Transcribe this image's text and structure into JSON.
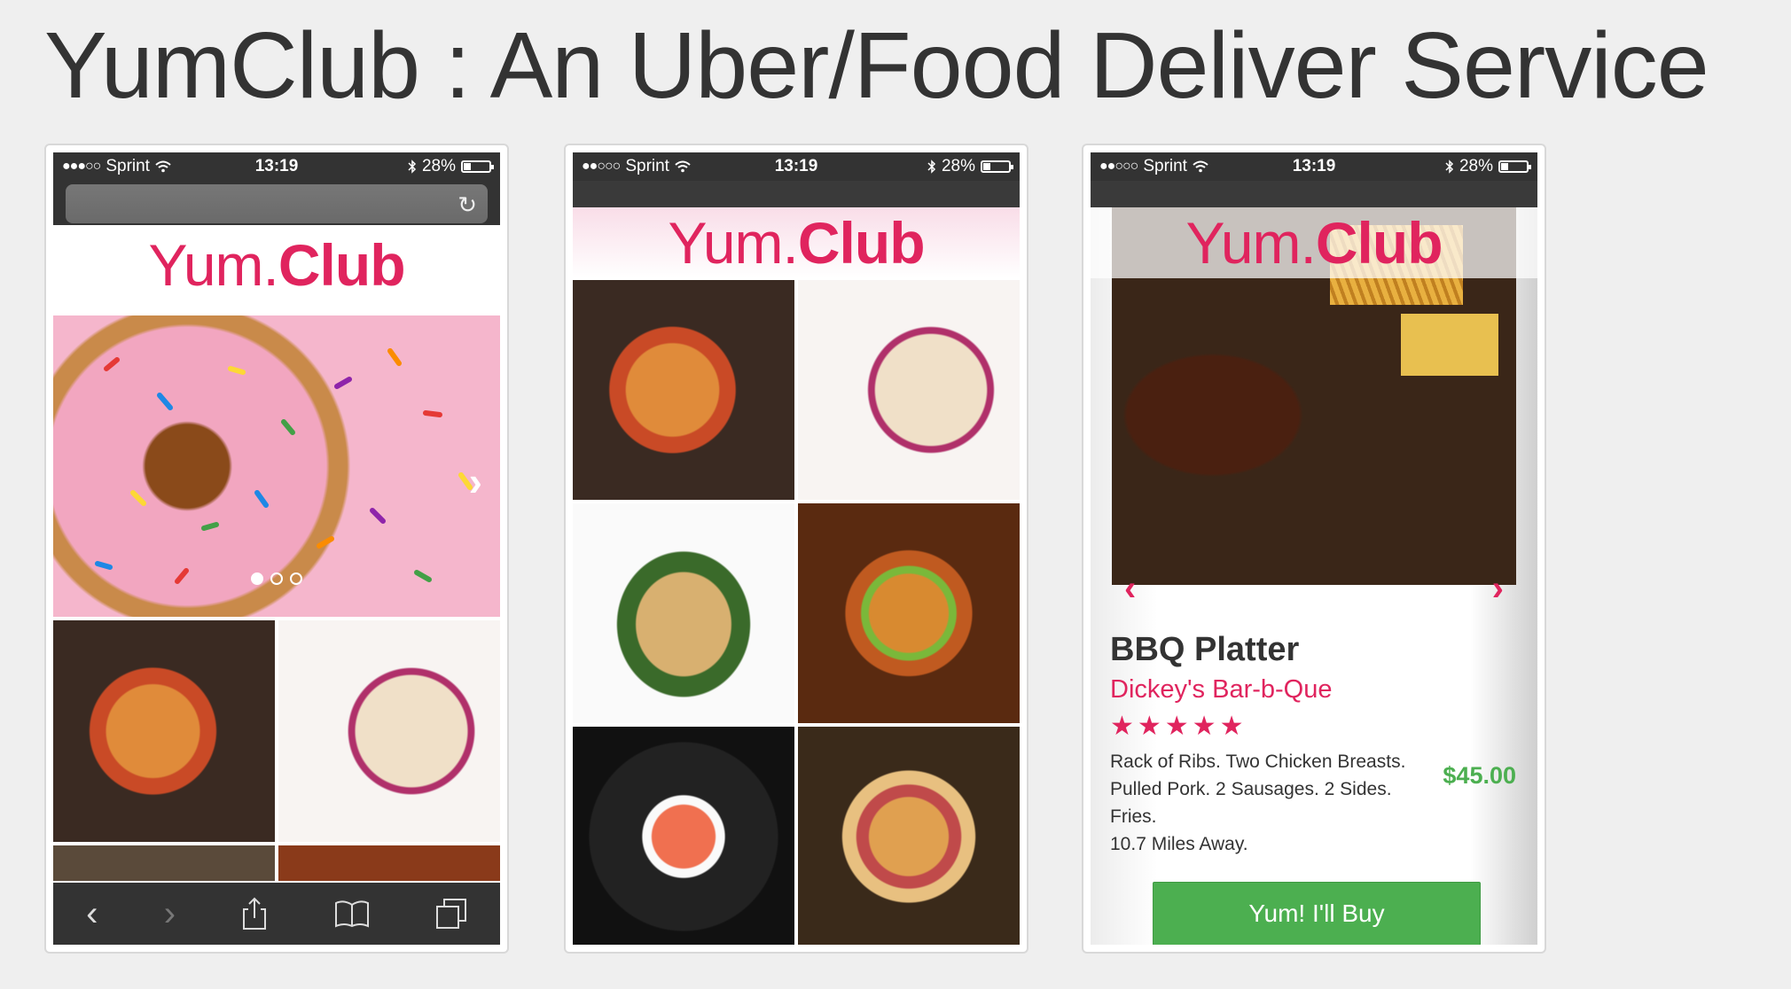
{
  "slide": {
    "title": "YumClub : An Uber/Food Deliver Service"
  },
  "status": {
    "signal": "●●●○○",
    "signal2": "●●○○○",
    "carrier": "Sprint",
    "time": "13:19",
    "battery_text": "28%",
    "battery_level": 0.28
  },
  "logo": {
    "light": "Yum.",
    "bold": "Club"
  },
  "browser": {
    "reload_icon": "reload-icon"
  },
  "carousel": {
    "dots_total": 3,
    "active": 1
  },
  "product": {
    "name": "BBQ Platter",
    "restaurant": "Dickey's Bar-b-Que",
    "stars": "★★★★★",
    "rating": 5,
    "description_lines": [
      "Rack of Ribs. Two Chicken Breasts.",
      "Pulled Pork. 2 Sausages. 2 Sides.",
      "Fries.",
      "10.7 Miles Away."
    ],
    "price": "$45.00",
    "buy_label": "Yum! I'll Buy"
  },
  "colors": {
    "brand": "#e0245e",
    "buy": "#4caf50",
    "price": "#4caf50",
    "chrome": "#333333"
  }
}
